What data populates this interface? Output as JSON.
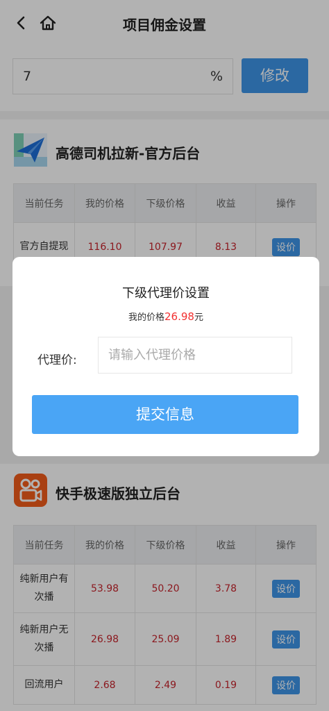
{
  "header": {
    "title": "项目佣金设置",
    "back_icon": "chevron-left-icon",
    "home_icon": "home-icon"
  },
  "commission": {
    "value": "7",
    "unit": "%",
    "modify_label": "修改"
  },
  "columns": [
    "当前任务",
    "我的价格",
    "下级价格",
    "收益",
    "操作"
  ],
  "projects": [
    {
      "name": "高德司机拉新-官方后台",
      "logo_icon": "paper-plane-icon",
      "rows": [
        {
          "task": "官方自提现",
          "my_price": "116.10",
          "sub_price": "107.97",
          "profit": "8.13",
          "action": "设价"
        }
      ]
    },
    {
      "name": "快手极速版独立后台",
      "logo_icon": "kuaishou-camera-icon",
      "rows": [
        {
          "task": "纯新用户有次播",
          "my_price": "53.98",
          "sub_price": "50.20",
          "profit": "3.78",
          "action": "设价"
        },
        {
          "task": "纯新用户无次播",
          "my_price": "26.98",
          "sub_price": "25.09",
          "profit": "1.89",
          "action": "设价"
        },
        {
          "task": "回流用户",
          "my_price": "2.68",
          "sub_price": "2.49",
          "profit": "0.19",
          "action": "设价"
        }
      ]
    }
  ],
  "modal": {
    "title": "下级代理价设置",
    "my_price_label": "我的价格",
    "my_price_value": "26.98",
    "my_price_unit": "元",
    "agent_label": "代理价:",
    "agent_placeholder": "请输入代理价格",
    "submit_label": "提交信息"
  },
  "colors": {
    "accent": "#3e95e8",
    "submit": "#4aa5f5",
    "price_red": "#c8232c",
    "modal_red": "#f23030"
  }
}
